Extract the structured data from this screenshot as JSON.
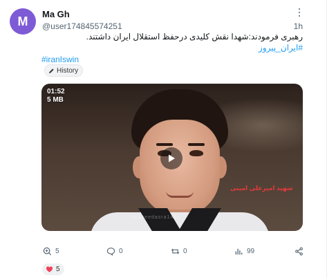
{
  "post": {
    "avatar_letter": "M",
    "display_name": "Ma Gh",
    "handle": "@user174845574251",
    "time": "1h",
    "text": "رهبری فرمودند:شهدا نقش کلیدی درحفظ استقلال ایران داشتند.",
    "hashtag_rtl": "#ایران_پیروز",
    "hashtag_ltr": "#iranIswin",
    "history_label": "History"
  },
  "video": {
    "duration": "01:52",
    "size": "5 MB",
    "caption": "شهید امیرعلی امینی",
    "watermark": "shaheedasra1403"
  },
  "actions": {
    "reposts_quote": "5",
    "comments": "0",
    "reposts": "0",
    "views": "99"
  },
  "reactions": {
    "hearts": "5"
  },
  "colors": {
    "avatar": "#7e5bd6",
    "link": "#1d9bf0",
    "heart": "#f0415a"
  }
}
